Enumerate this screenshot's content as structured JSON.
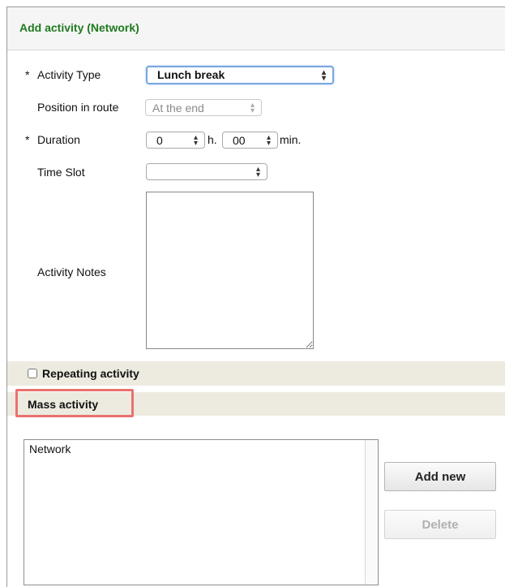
{
  "header": {
    "title": "Add activity (Network)"
  },
  "form": {
    "required_marker": "*",
    "activity_type": {
      "label": "Activity Type",
      "value": "Lunch break"
    },
    "position_in_route": {
      "label": "Position in route",
      "value": "At the end"
    },
    "duration": {
      "label": "Duration",
      "hours_value": "0",
      "hours_unit": "h.",
      "minutes_value": "00",
      "minutes_unit": "min."
    },
    "time_slot": {
      "label": "Time Slot",
      "value": ""
    },
    "activity_notes": {
      "label": "Activity Notes",
      "value": ""
    }
  },
  "repeating": {
    "label": "Repeating activity",
    "checked": false
  },
  "mass": {
    "label": "Mass activity",
    "list_items": [
      "Network"
    ],
    "add_button": "Add new",
    "delete_button": "Delete"
  },
  "colors": {
    "header_title": "#1f7a1f",
    "band": "#edeae0",
    "highlight_border": "#e8726e",
    "focus_ring": "#7aa6e0"
  }
}
